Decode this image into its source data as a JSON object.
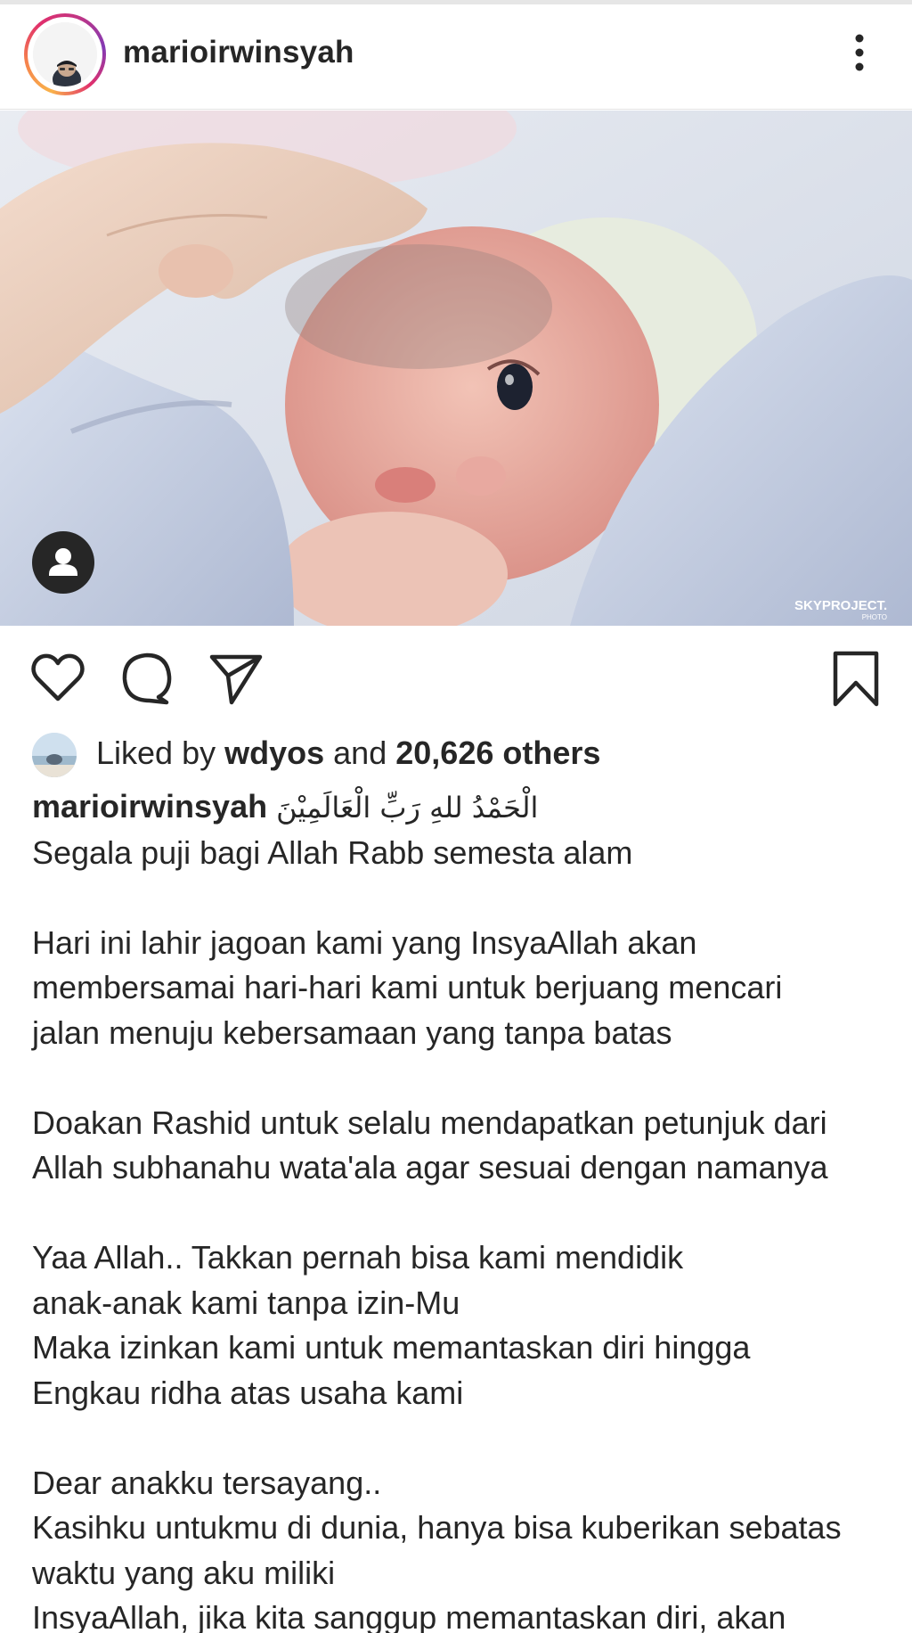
{
  "post": {
    "username": "marioirwinsyah",
    "more_icon": "more-vertical-icon",
    "photo_alt": "newborn baby photo",
    "tag_icon": "user-tag-icon",
    "watermark_main": "SKYPROJECT.",
    "watermark_sub": "PHOTO"
  },
  "actions": {
    "like_icon": "heart-icon",
    "comment_icon": "comment-icon",
    "share_icon": "send-icon",
    "save_icon": "bookmark-icon"
  },
  "likes": {
    "prefix": "Liked by",
    "user": "wdyos",
    "middle": "and",
    "others": "20,626 others"
  },
  "caption": {
    "user": "marioirwinsyah",
    "arabic": "الْحَمْدُ للهِ رَبِّ الْعَالَمِيْنَ",
    "lines": [
      "Segala puji bagi Allah Rabb semesta alam",
      "",
      "Hari ini lahir jagoan kami yang InsyaAllah akan",
      "membersamai hari-hari kami untuk berjuang mencari",
      "jalan menuju kebersamaan yang tanpa batas",
      "",
      "Doakan Rashid untuk selalu mendapatkan petunjuk dari",
      "Allah subhanahu wata'ala agar sesuai dengan namanya",
      "",
      "Yaa Allah.. Takkan pernah bisa kami mendidik",
      "anak-anak kami tanpa izin-Mu",
      "Maka izinkan kami  untuk memantaskan diri hingga",
      "Engkau ridha atas usaha kami",
      "",
      "Dear anakku tersayang..",
      "Kasihku untukmu di dunia, hanya bisa kuberikan sebatas",
      "waktu yang aku miliki",
      "InsyaAllah, jika kita  sanggup memantaskan diri, akan"
    ]
  }
}
